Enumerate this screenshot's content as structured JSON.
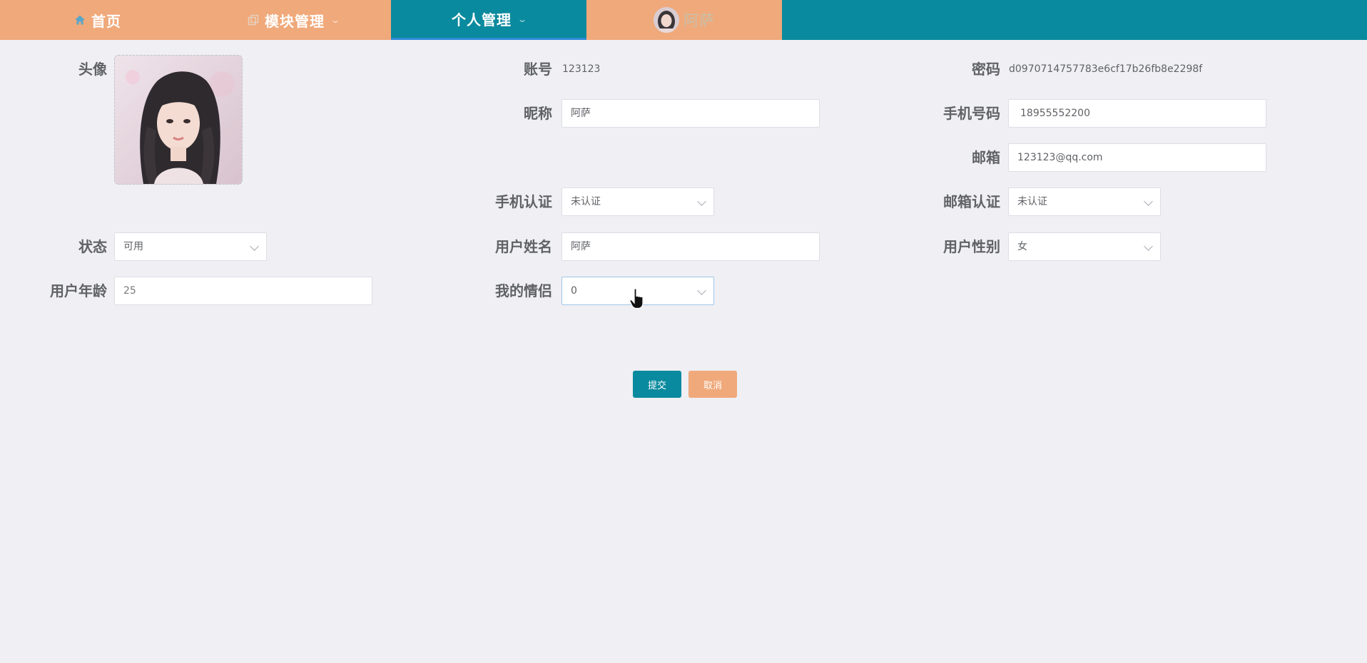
{
  "nav": {
    "home": "首页",
    "module": "模块管理",
    "personal": "个人管理",
    "username": "阿萨",
    "home_icon": "home-icon",
    "module_icon": "copy-icon",
    "active_color": "#0a8a9e",
    "inactive_color": "#f0a97a"
  },
  "form": {
    "avatar_label": "头像",
    "account_label": "账号",
    "account_value": "123123",
    "password_label": "密码",
    "password_value": "d0970714757783e6cf17b26fb8e2298f",
    "nickname_label": "昵称",
    "nickname_value": "阿萨",
    "phone_label": "手机号码",
    "phone_value": "18955552200",
    "email_label": "邮箱",
    "email_value": "123123@qq.com",
    "phone_verify_label": "手机认证",
    "phone_verify_value": "未认证",
    "email_verify_label": "邮箱认证",
    "email_verify_value": "未认证",
    "status_label": "状态",
    "status_value": "可用",
    "realname_label": "用户姓名",
    "realname_value": "阿萨",
    "gender_label": "用户性别",
    "gender_value": "女",
    "age_label": "用户年龄",
    "age_value": "25",
    "partner_label": "我的情侣",
    "partner_value": "0"
  },
  "actions": {
    "submit": "提交",
    "cancel": "取消"
  }
}
